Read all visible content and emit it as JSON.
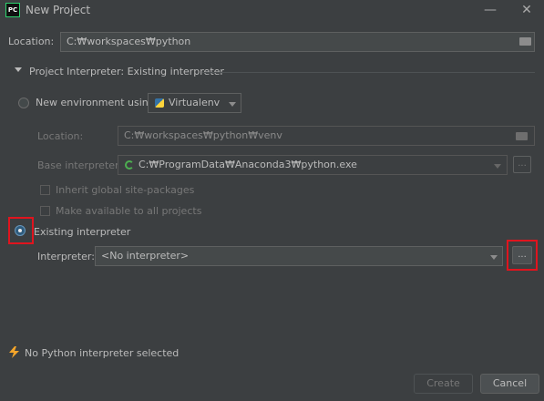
{
  "window": {
    "title": "New Project",
    "app_icon": "PC",
    "minimize_glyph": "—",
    "close_glyph": "✕"
  },
  "location": {
    "label": "Location:",
    "value": "C:₩workspaces₩python",
    "icon": "folder-icon"
  },
  "section": {
    "title": "Project Interpreter: Existing interpreter"
  },
  "new_env": {
    "radio_label": "New environment using",
    "tool": "Virtualenv",
    "location_label": "Location:",
    "location_value": "C:₩workspaces₩python₩venv",
    "base_label": "Base interpreter:",
    "base_value": "C:₩ProgramData₩Anaconda3₩python.exe",
    "inherit_label": "Inherit global site-packages",
    "available_label": "Make available to all projects"
  },
  "existing": {
    "radio_label": "Existing interpreter",
    "interpreter_label": "Interpreter:",
    "interpreter_value": "<No interpreter>",
    "browse_label": "..."
  },
  "status": {
    "message": "No Python interpreter selected",
    "icon": "lightning-icon"
  },
  "buttons": {
    "create": "Create",
    "cancel": "Cancel",
    "base_browse": "..."
  },
  "colors": {
    "background": "#3c3f41",
    "highlight": "#e0141e",
    "warning": "#f4a52a"
  }
}
